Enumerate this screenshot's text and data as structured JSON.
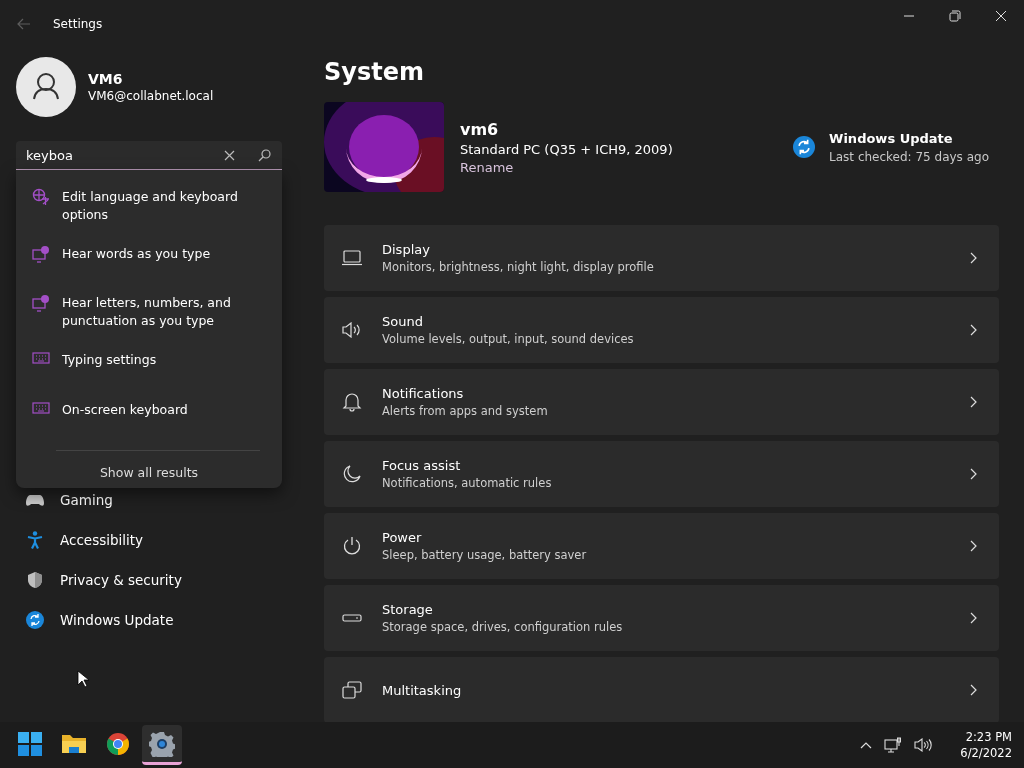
{
  "window": {
    "title": "Settings"
  },
  "profile": {
    "name": "VM6",
    "email": "VM6@collabnet.local"
  },
  "search": {
    "value": "keyboa"
  },
  "search_results": [
    {
      "label": "Edit language and keyboard options",
      "kind": "language"
    },
    {
      "label": "Hear words as you type",
      "kind": "narrator"
    },
    {
      "label": "Hear letters, numbers, and punctuation as you type",
      "kind": "narrator"
    },
    {
      "label": "Typing settings",
      "kind": "keyboard"
    },
    {
      "label": "On-screen keyboard",
      "kind": "keyboard"
    }
  ],
  "show_all": "Show all results",
  "sidebar": {
    "items": [
      {
        "label": "Gaming",
        "kind": "gaming"
      },
      {
        "label": "Accessibility",
        "kind": "accessibility"
      },
      {
        "label": "Privacy & security",
        "kind": "privacy"
      },
      {
        "label": "Windows Update",
        "kind": "update"
      }
    ]
  },
  "page_title": "System",
  "device": {
    "name": "vm6",
    "model": "Standard PC (Q35 + ICH9, 2009)",
    "rename": "Rename"
  },
  "update": {
    "title": "Windows Update",
    "status": "Last checked: 75 days ago"
  },
  "settings": [
    {
      "title": "Display",
      "subtitle": "Monitors, brightness, night light, display profile",
      "kind": "display"
    },
    {
      "title": "Sound",
      "subtitle": "Volume levels, output, input, sound devices",
      "kind": "sound"
    },
    {
      "title": "Notifications",
      "subtitle": "Alerts from apps and system",
      "kind": "notifications"
    },
    {
      "title": "Focus assist",
      "subtitle": "Notifications, automatic rules",
      "kind": "focus"
    },
    {
      "title": "Power",
      "subtitle": "Sleep, battery usage, battery saver",
      "kind": "power"
    },
    {
      "title": "Storage",
      "subtitle": "Storage space, drives, configuration rules",
      "kind": "storage"
    },
    {
      "title": "Multitasking",
      "kind": "multitasking"
    }
  ],
  "taskbar": {
    "apps": [
      {
        "kind": "start",
        "selected": false
      },
      {
        "kind": "explorer",
        "selected": false
      },
      {
        "kind": "chrome",
        "selected": false
      },
      {
        "kind": "settings",
        "selected": true
      }
    ],
    "time": "2:23 PM",
    "date": "6/2/2022"
  }
}
